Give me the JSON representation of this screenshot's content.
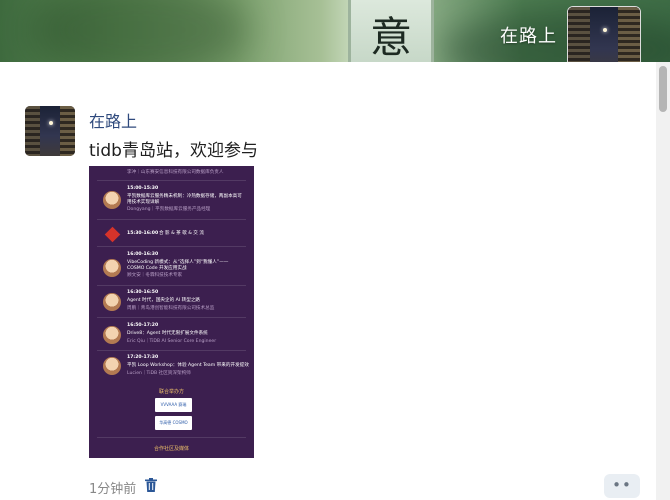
{
  "cover": {
    "plaque_char": "意",
    "title": "在路上"
  },
  "post": {
    "author": "在路上",
    "text": "tidb青岛站，欢迎参与",
    "time_ago": "1分钟前",
    "more_label": "••"
  },
  "poster": {
    "top_partial": "李冲｜山东赛安信息科技有限公司数据库负责人",
    "sessions": [
      {
        "time": "15:00-15:30",
        "title": "平凯数据库云服务精未机制：冷热数据存储，两副本高可用技术实现详解",
        "speaker": "Dongyang｜平凯数据库云服务产品经理"
      },
      {
        "time": "15:30-16:00",
        "title": "合 影 & 茶 歇 & 交 流",
        "speaker": ""
      },
      {
        "time": "16:00-16:30",
        "title": "VibeCoding 新模式：从“选择人”到“我懂人”——COSMO Code 开发应用实战",
        "speaker": "顾文安｜冬霖科技技术专家"
      },
      {
        "time": "16:30-16:50",
        "title": "Agent 时代，国央企的 AI 转型之路",
        "speaker": "周鹏｜青岛港创智能科技有限公司技术总监"
      },
      {
        "time": "16:50-17:20",
        "title": "Drive8：Agent 时代无限扩展文件系统",
        "speaker": "Eric Qiu｜TiDB AI  Senior Core Engineer"
      },
      {
        "time": "17:20-17:30",
        "title": "平凯 Loop Workshop：体验 Agent Team 带来的开发提效",
        "speaker": "Lucien｜TiDB 社区资深架构师"
      }
    ],
    "organizers_label": "联合举办方",
    "logo1": "VVVAAA 赛瑞",
    "logo2": "华高德 COSMO",
    "media_label": "合作社区及媒体"
  },
  "colors": {
    "accent_blue": "#2f4a7d",
    "poster_bg": "#3c1f4f",
    "poster_gold": "#f0c36a"
  },
  "icons": [
    "trash-icon",
    "more-icon"
  ]
}
